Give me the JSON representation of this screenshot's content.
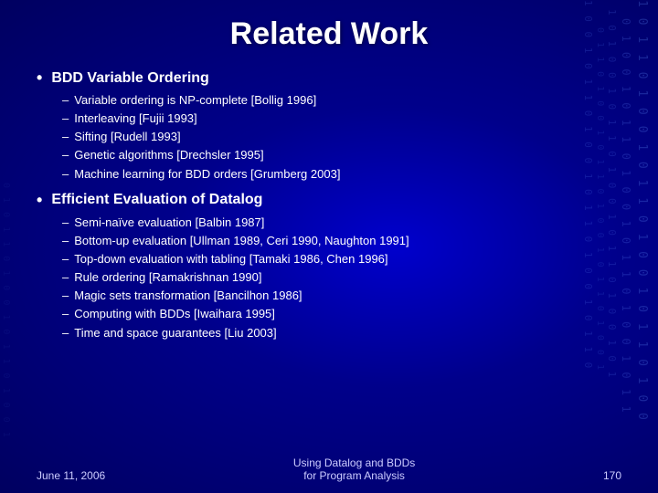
{
  "title": "Related Work",
  "sections": [
    {
      "heading": "BDD Variable Ordering",
      "items": [
        "Variable ordering is NP-complete [Bollig 1996]",
        "Interleaving [Fujii 1993]",
        "Sifting [Rudell 1993]",
        "Genetic algorithms [Drechsler 1995]",
        "Machine learning for BDD orders [Grumberg 2003]"
      ]
    },
    {
      "heading": "Efficient Evaluation of Datalog",
      "items": [
        "Semi-naïve evaluation [Balbin 1987]",
        "Bottom-up evaluation [Ullman 1989, Ceri 1990, Naughton 1991]",
        "Top-down evaluation with tabling [Tamaki 1986, Chen 1996]",
        "Rule ordering [Ramakrishnan 1990]",
        "Magic sets transformation [Bancilhon 1986]",
        "Computing with BDDs [Iwaihara 1995]",
        "Time and space guarantees [Liu 2003]"
      ]
    }
  ],
  "footer": {
    "left": "June 11, 2006",
    "center_line1": "Using Datalog and BDDs",
    "center_line2": "for Program Analysis",
    "right": "170"
  },
  "binary_strings": [
    "10110100101101001011010010",
    "01001011010010110100101101",
    "10100101101001011010010110",
    "01101001011010010110100101",
    "10010110100101101001011010",
    "01011010010110100101101001"
  ]
}
